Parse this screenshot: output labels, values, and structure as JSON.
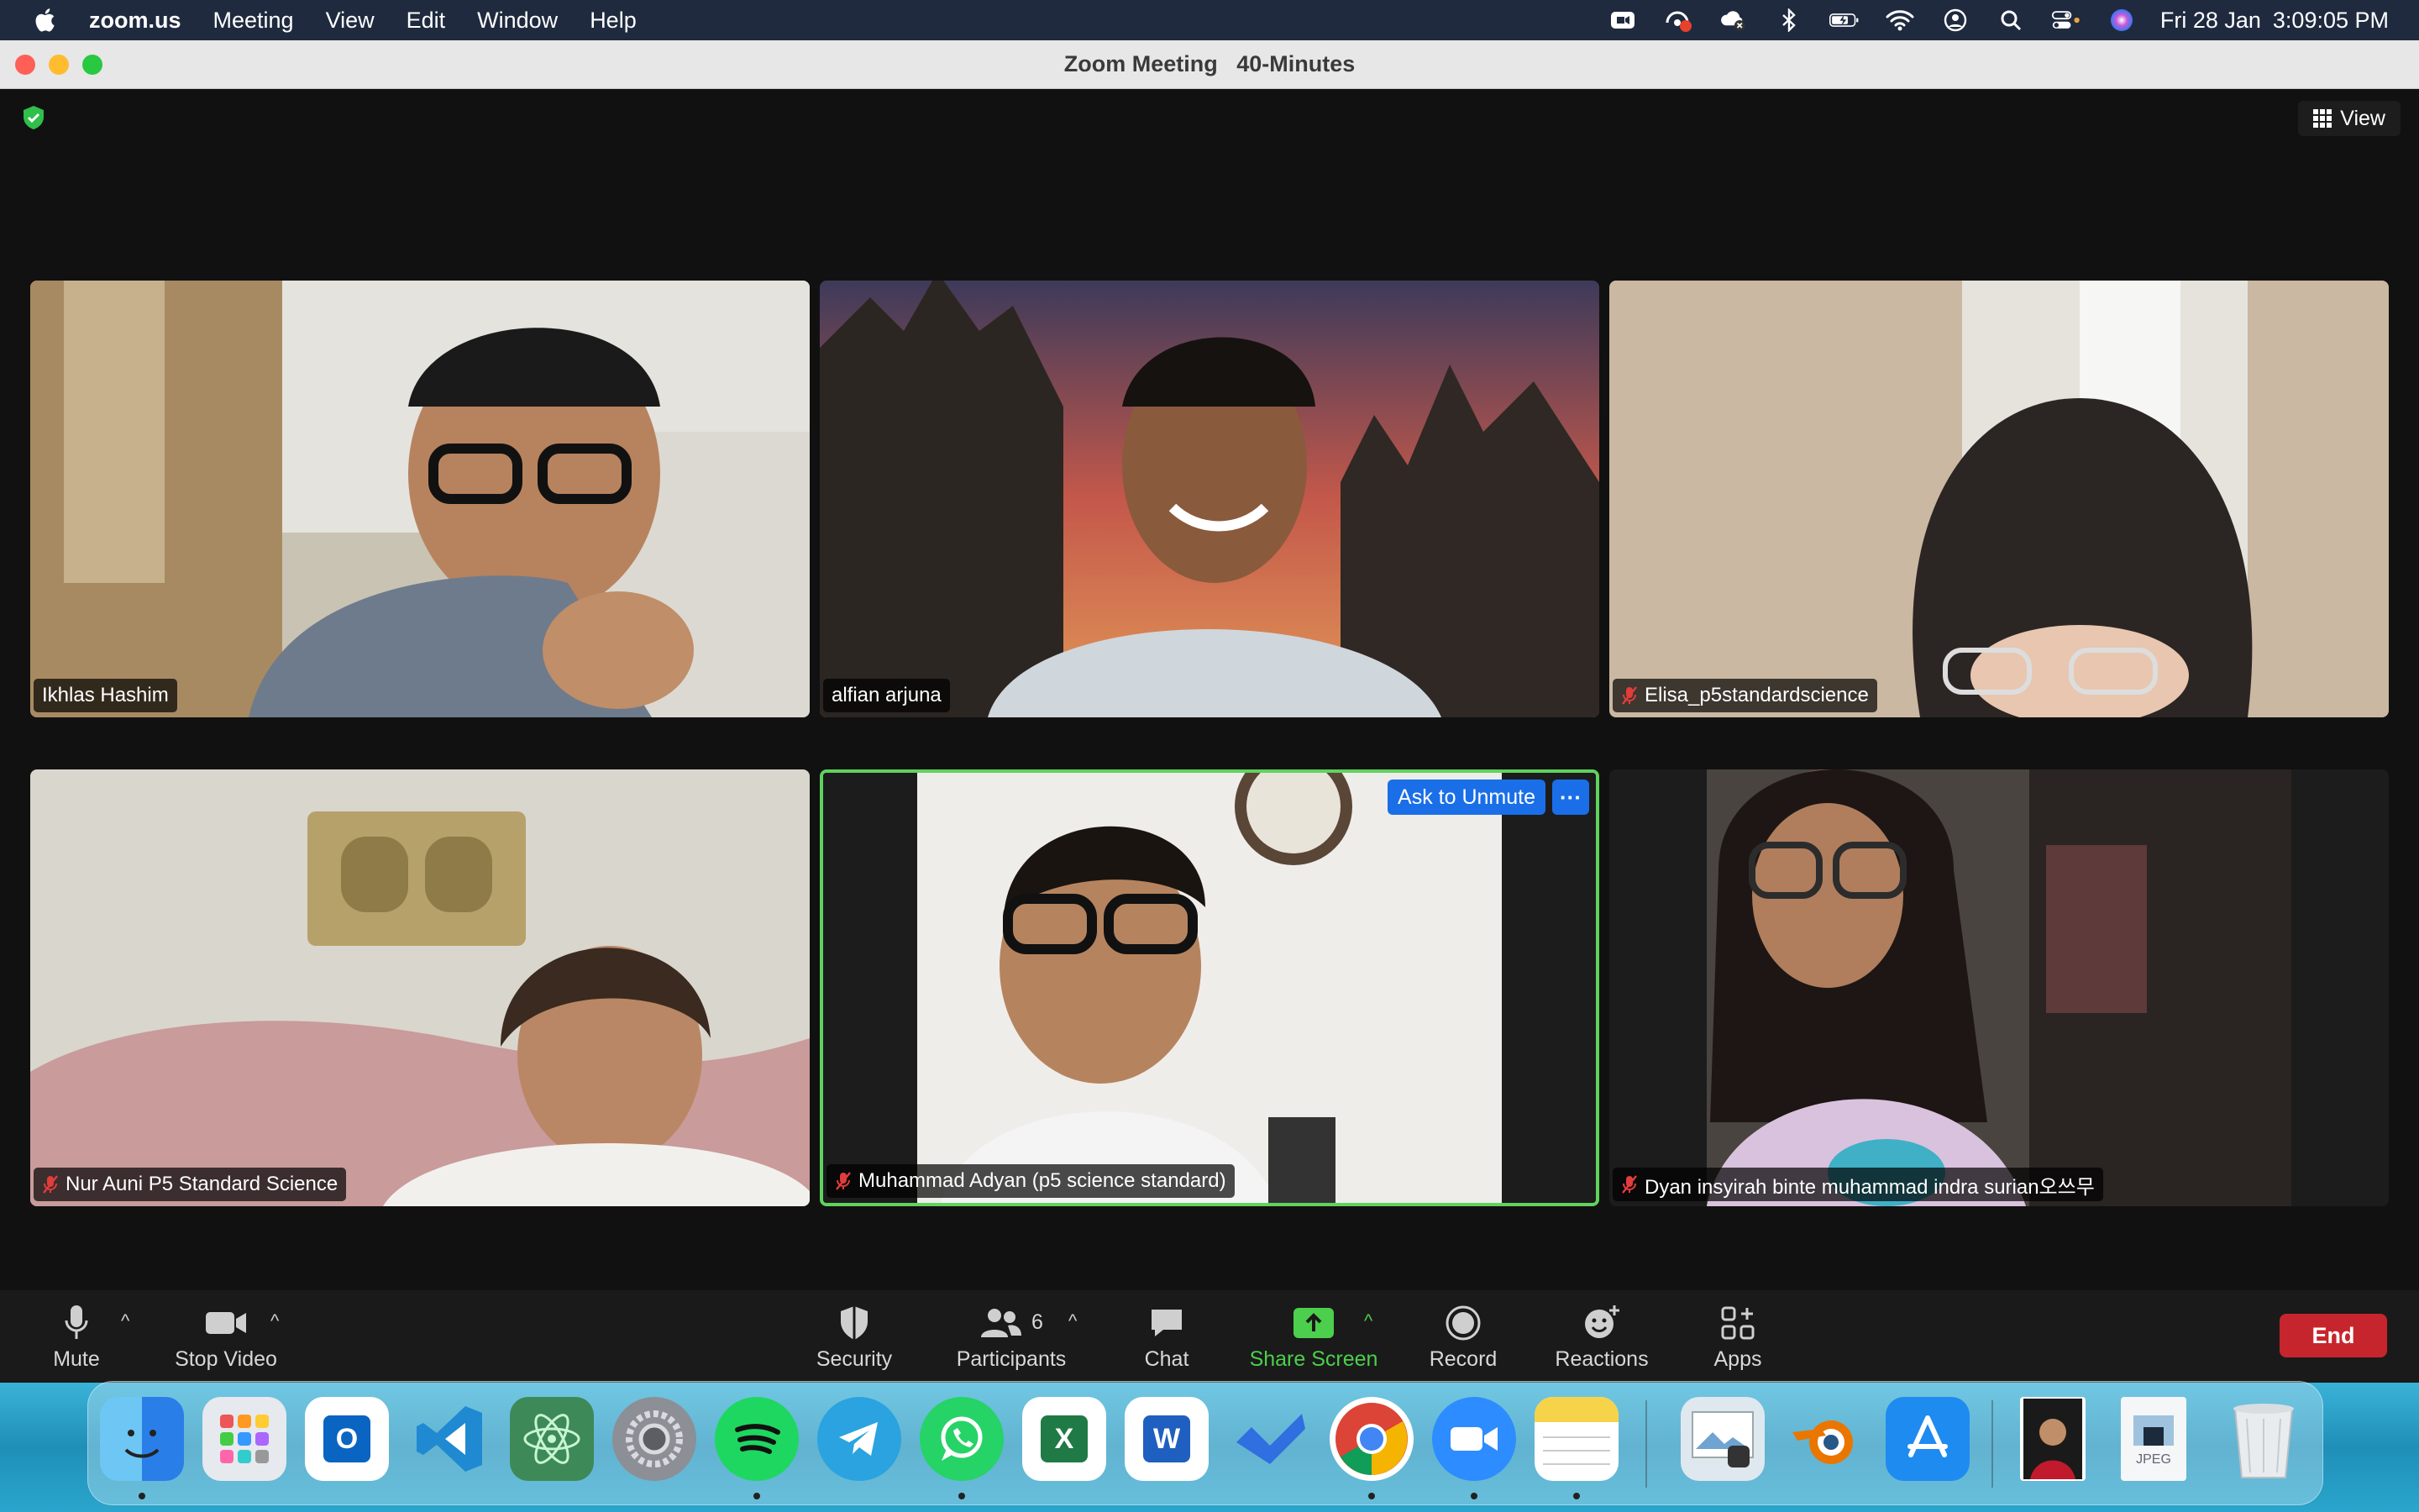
{
  "menubar": {
    "app_name": "zoom.us",
    "items": [
      "Meeting",
      "View",
      "Edit",
      "Window",
      "Help"
    ],
    "status_icons": [
      "zoom-camera-icon",
      "screen-share-record-icon",
      "cloud-icon",
      "bluetooth-icon",
      "battery-icon",
      "wifi-icon",
      "user-account-icon",
      "spotlight-search-icon",
      "control-center-icon",
      "siri-icon"
    ],
    "date": "Fri 28 Jan",
    "time": "3:09:05 PM"
  },
  "window": {
    "title": "Zoom Meeting   40-Minutes",
    "view_label": "View"
  },
  "participants": [
    {
      "name": "Ikhlas Hashim",
      "muted": false
    },
    {
      "name": "alfian arjuna",
      "muted": false
    },
    {
      "name": "Elisa_p5standardscience",
      "muted": true
    },
    {
      "name": "Nur Auni P5 Standard Science",
      "muted": true
    },
    {
      "name": "Muhammad Adyan (p5 science standard)",
      "muted": true,
      "active_speaker": true
    },
    {
      "name": "Dyan insyirah binte muhammad indra surian오쓰무",
      "muted": true
    }
  ],
  "active_tile": {
    "ask_unmute_label": "Ask to Unmute",
    "more_label": "···"
  },
  "toolbar": {
    "mute_label": "Mute",
    "stop_video_label": "Stop Video",
    "security_label": "Security",
    "participants_label": "Participants",
    "participants_count": "6",
    "chat_label": "Chat",
    "share_label": "Share Screen",
    "record_label": "Record",
    "reactions_label": "Reactions",
    "apps_label": "Apps",
    "end_label": "End"
  },
  "dock": {
    "apps": [
      "finder-icon",
      "launchpad-icon",
      "outlook-icon",
      "vscode-icon",
      "atom-icon",
      "system-preferences-icon",
      "spotify-icon",
      "telegram-icon",
      "whatsapp-icon",
      "excel-icon",
      "word-icon",
      "todo-icon",
      "chrome-icon",
      "zoom-icon",
      "notes-icon",
      "preview-icon",
      "blender-icon",
      "app-store-icon",
      "photo-file-icon",
      "jpeg-file-icon",
      "trash-icon"
    ],
    "outlook_letter": "O",
    "excel_letter": "X",
    "word_letter": "W",
    "jpeg_label": "JPEG"
  },
  "colors": {
    "active_border": "#5fd35d",
    "end_button": "#c7252d",
    "ask_unmute": "#1a6fe8",
    "share_green": "#4ccf4c"
  }
}
